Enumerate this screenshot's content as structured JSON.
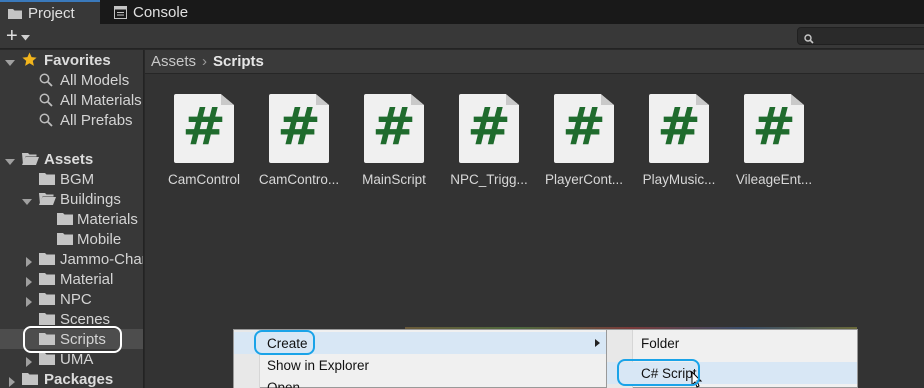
{
  "tabs": [
    {
      "label": "Project",
      "icon": "folder-icon",
      "active": true
    },
    {
      "label": "Console",
      "icon": "console-icon",
      "active": false
    }
  ],
  "toolbar": {
    "add_label": "+"
  },
  "sidebar": {
    "items": [
      {
        "label": "Favorites",
        "icon": "star-icon",
        "bold": true,
        "expanded": true
      },
      {
        "label": "All Models",
        "icon": "search-icon"
      },
      {
        "label": "All Materials",
        "icon": "search-icon"
      },
      {
        "label": "All Prefabs",
        "icon": "search-icon"
      },
      {
        "label": "Assets",
        "icon": "folder-open-icon",
        "bold": true,
        "expanded": true
      },
      {
        "label": "BGM",
        "icon": "folder-icon"
      },
      {
        "label": "Buildings",
        "icon": "folder-open-icon",
        "expanded": true
      },
      {
        "label": "Materials",
        "icon": "folder-icon"
      },
      {
        "label": "Mobile",
        "icon": "folder-icon"
      },
      {
        "label": "Jammo-Character",
        "icon": "folder-icon"
      },
      {
        "label": "Material",
        "icon": "folder-icon"
      },
      {
        "label": "NPC",
        "icon": "folder-icon"
      },
      {
        "label": "Scenes",
        "icon": "folder-icon"
      },
      {
        "label": "Scripts",
        "icon": "folder-icon",
        "selected": true
      },
      {
        "label": "UMA",
        "icon": "folder-icon"
      },
      {
        "label": "Packages",
        "icon": "folder-icon",
        "bold": true
      }
    ]
  },
  "breadcrumb": {
    "root": "Assets",
    "separator": "›",
    "current": "Scripts"
  },
  "assets": [
    {
      "name": "CamControl",
      "glyph": "#"
    },
    {
      "name": "CamContro...",
      "glyph": "#"
    },
    {
      "name": "MainScript",
      "glyph": "#"
    },
    {
      "name": "NPC_Trigg...",
      "glyph": "#"
    },
    {
      "name": "PlayerCont...",
      "glyph": "#"
    },
    {
      "name": "PlayMusic...",
      "glyph": "#"
    },
    {
      "name": "VileageEnt...",
      "glyph": "#"
    }
  ],
  "context_menu": {
    "items": [
      {
        "label": "Create",
        "has_submenu": true,
        "highlighted": true
      },
      {
        "label": "Show in Explorer"
      },
      {
        "label": "Open"
      }
    ]
  },
  "submenu": {
    "items": [
      {
        "label": "Folder"
      },
      {
        "label": "C# Script",
        "highlighted": true
      }
    ]
  },
  "colors": {
    "accent_outline_white": "#ffffff",
    "accent_outline_blue": "#1aa3e8",
    "script_hash": "#1f6b2d"
  }
}
